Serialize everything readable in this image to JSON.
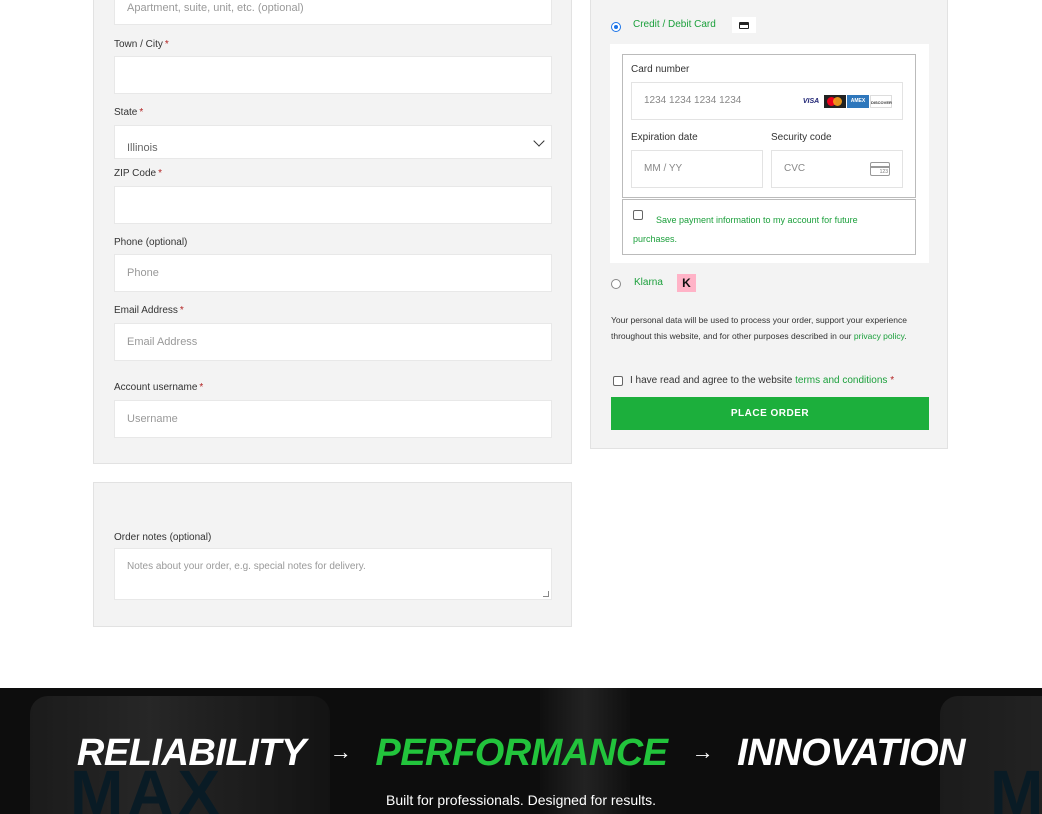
{
  "billing": {
    "address2_placeholder": "Apartment, suite, unit, etc. (optional)",
    "town_label": "Town / City",
    "state_label": "State",
    "state_value": "Illinois",
    "zip_label": "ZIP Code",
    "phone_label": "Phone (optional)",
    "phone_placeholder": "Phone",
    "email_label": "Email Address",
    "email_placeholder": "Email Address",
    "username_label": "Account username",
    "username_placeholder": "Username",
    "required_mark": "*"
  },
  "notes": {
    "label": "Order notes (optional)",
    "placeholder": "Notes about your order, e.g. special notes for delivery."
  },
  "payment": {
    "card_option_label": "Credit / Debit Card",
    "card_number_label": "Card number",
    "card_number_placeholder": "1234 1234 1234 1234",
    "brands": [
      "VISA",
      "mastercard",
      "AMEX",
      "DISCOVER"
    ],
    "expiry_label": "Expiration date",
    "expiry_placeholder": "MM / YY",
    "cvc_label": "Security code",
    "cvc_placeholder": "CVC",
    "cvc_icon_text": "123",
    "save_label": "Save payment information to my account for future purchases.",
    "klarna_label": "Klarna",
    "klarna_logo": "K",
    "privacy_text": "Your personal data will be used to process your order, support your experience throughout this website, and for other purposes described in our",
    "privacy_link": "privacy policy",
    "terms_prefix": "I have read and agree to the website",
    "terms_link": "terms and conditions",
    "place_order": "PLACE ORDER"
  },
  "banner": {
    "word1": "RELIABILITY",
    "word2": "PERFORMANCE",
    "word3": "INNOVATION",
    "arrow": "→",
    "tagline": "Built for professionals. Designed for results."
  },
  "colors": {
    "accent_green": "#1caf3c",
    "banner_bg": "#151515",
    "radio_blue": "#1a73e8"
  }
}
